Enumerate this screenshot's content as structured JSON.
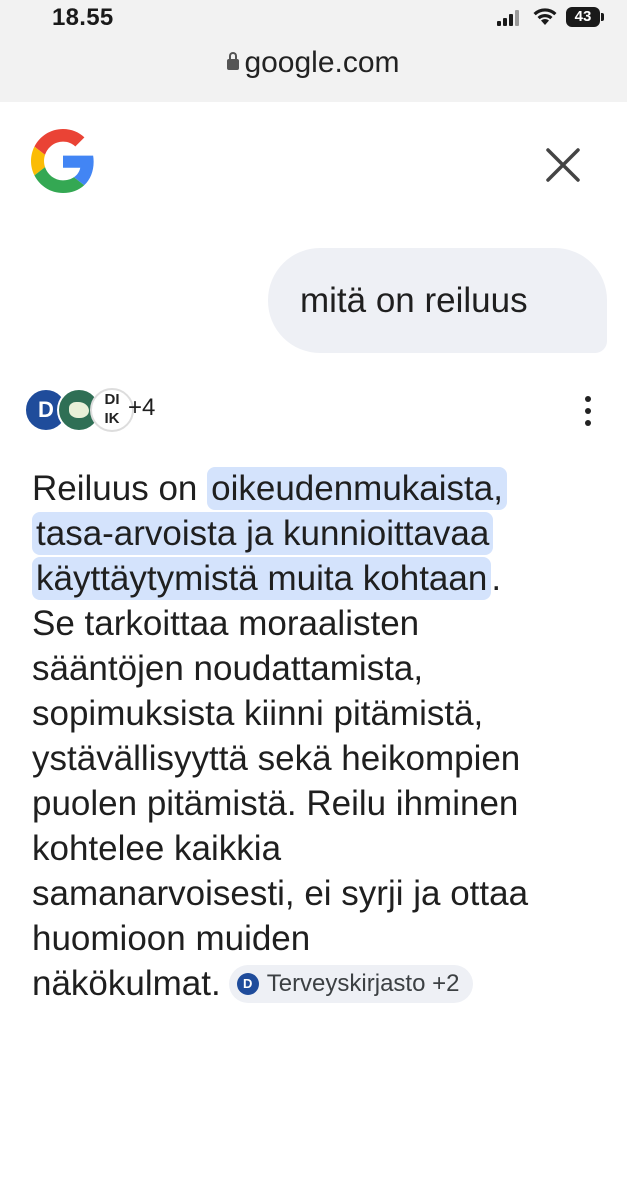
{
  "status_bar": {
    "time": "18.55",
    "battery": "43"
  },
  "browser": {
    "url": "google.com"
  },
  "header": {
    "logo_icon": "google-g-logo-icon",
    "close_icon": "close-icon"
  },
  "query": {
    "text": "mitä on reiluus"
  },
  "sources": {
    "icons": [
      "duodecim-d-icon",
      "green-seal-logo-icon",
      "dik-logo-icon"
    ],
    "more": "+4",
    "d_letter": "D",
    "k_letters": "DI\nIK"
  },
  "answer": {
    "lines": [
      {
        "pre": "Reiluus on ",
        "hl": "oikeudenmukaista,",
        "post": ""
      },
      {
        "pre": "",
        "hl": "tasa-arvoista ja kunnioittavaa",
        "post": ""
      },
      {
        "pre": "",
        "hl": "käyttäytymistä muita kohtaan",
        "post": "."
      },
      {
        "pre": "Se tarkoittaa moraalisten",
        "hl": "",
        "post": ""
      },
      {
        "pre": "sääntöjen noudattamista,",
        "hl": "",
        "post": ""
      },
      {
        "pre": "sopimuksista kiinni pitämistä,",
        "hl": "",
        "post": ""
      },
      {
        "pre": "ystävällisyyttä sekä heikompien",
        "hl": "",
        "post": ""
      },
      {
        "pre": "puolen pitämistä. Reilu ihminen",
        "hl": "",
        "post": ""
      },
      {
        "pre": "kohtelee kaikkia",
        "hl": "",
        "post": ""
      },
      {
        "pre": "samanarvoisesti, ei syrji ja ottaa",
        "hl": "",
        "post": ""
      },
      {
        "pre": "huomioon muiden",
        "hl": "",
        "post": ""
      },
      {
        "pre": "näkökulmat.",
        "hl": "",
        "post": ""
      }
    ],
    "citation_chip": {
      "label": "Terveyskirjasto +2",
      "icon_letter": "D"
    }
  },
  "colors": {
    "highlight": "#d4e3fc",
    "bubble": "#eef0f5",
    "duodecim_blue": "#1f4c9b"
  }
}
